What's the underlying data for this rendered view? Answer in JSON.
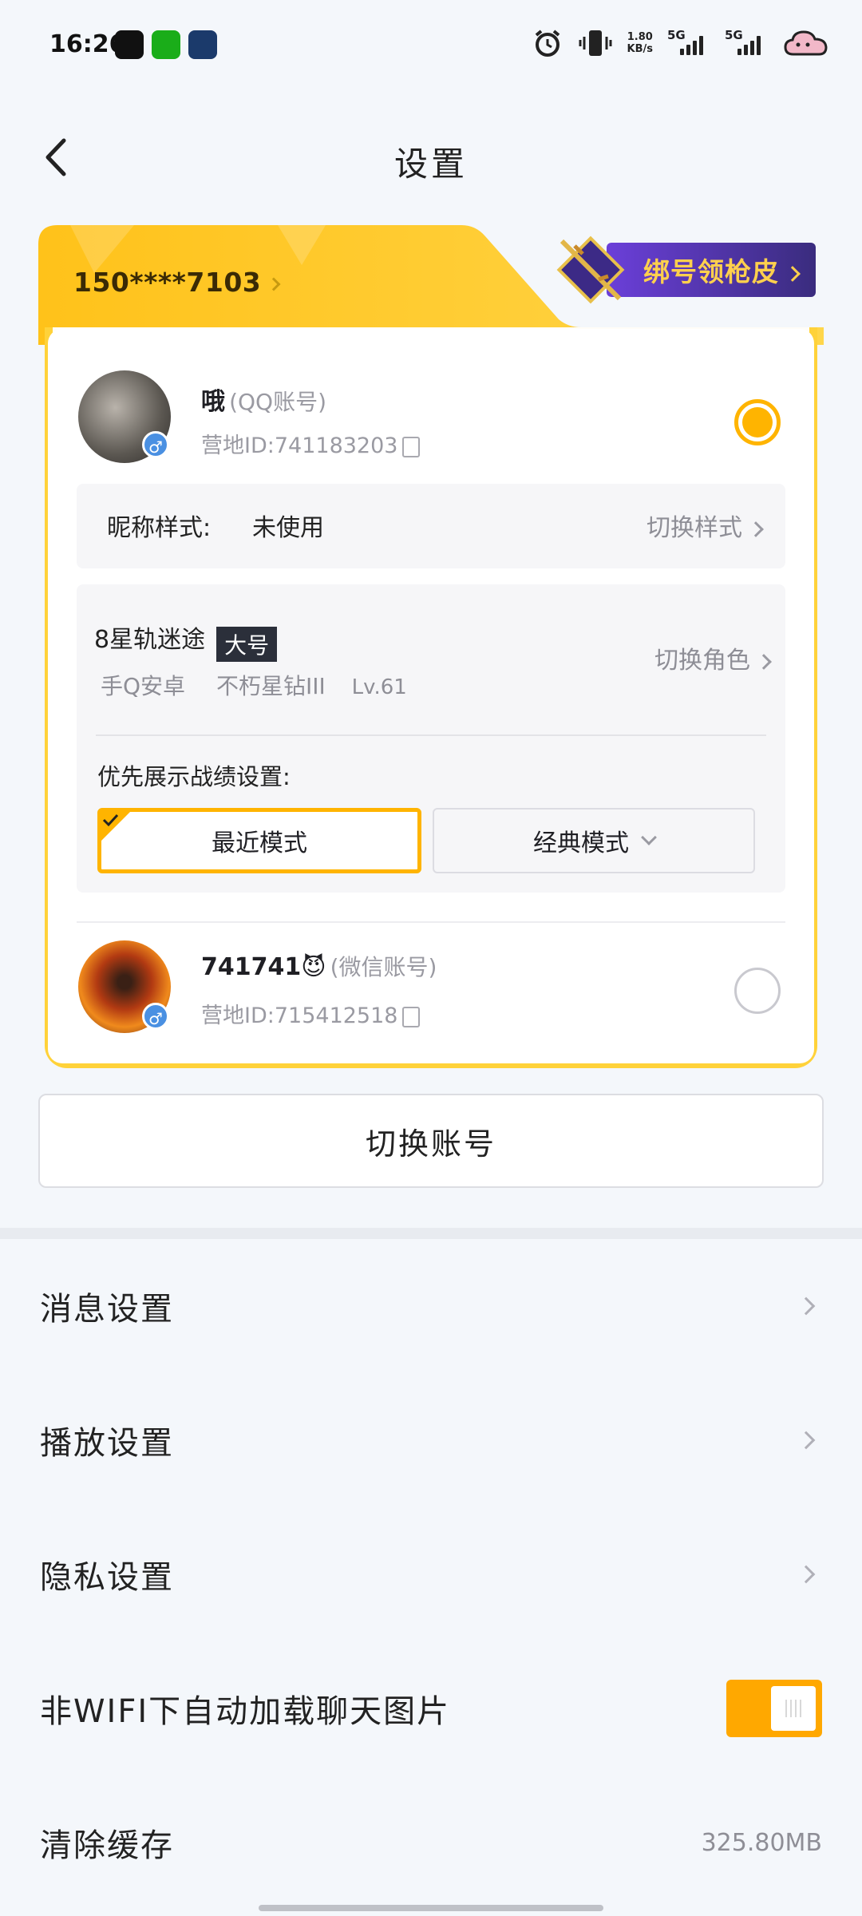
{
  "status_bar": {
    "time": "16:26",
    "net_speed_value": "1.80",
    "net_speed_unit": "KB/s",
    "signal1": "5G",
    "signal2": "5G"
  },
  "header": {
    "title": "设置"
  },
  "account_card": {
    "phone": "150****7103",
    "bind_promo": "绑号领枪皮",
    "accounts": [
      {
        "name": "哦",
        "type": "(QQ账号)",
        "id_label": "营地ID:741183203",
        "selected": true
      },
      {
        "name": "741741😈",
        "type": "(微信账号)",
        "id_label": "营地ID:715412518",
        "selected": false
      }
    ],
    "nickname_style": {
      "label": "昵称样式:",
      "value": "未使用",
      "action": "切换样式"
    },
    "role": {
      "name": "8星轨迷途",
      "tag": "大号",
      "platform": "手Q安卓",
      "rank": "不朽星钻III",
      "level": "Lv.61",
      "action": "切换角色"
    },
    "record_display": {
      "label": "优先展示战绩设置:",
      "option_recent": "最近模式",
      "option_classic": "经典模式",
      "selected": "最近模式"
    }
  },
  "switch_account_label": "切换账号",
  "settings": {
    "message": "消息设置",
    "playback": "播放设置",
    "privacy": "隐私设置",
    "wifi_images": "非WIFI下自动加载聊天图片",
    "wifi_images_enabled": true,
    "clear_cache": "清除缓存",
    "cache_size": "325.80MB"
  },
  "colors": {
    "accent": "#ffb400",
    "card_yellow": "#ffd23a",
    "promo_purple": "#5a38c2"
  }
}
